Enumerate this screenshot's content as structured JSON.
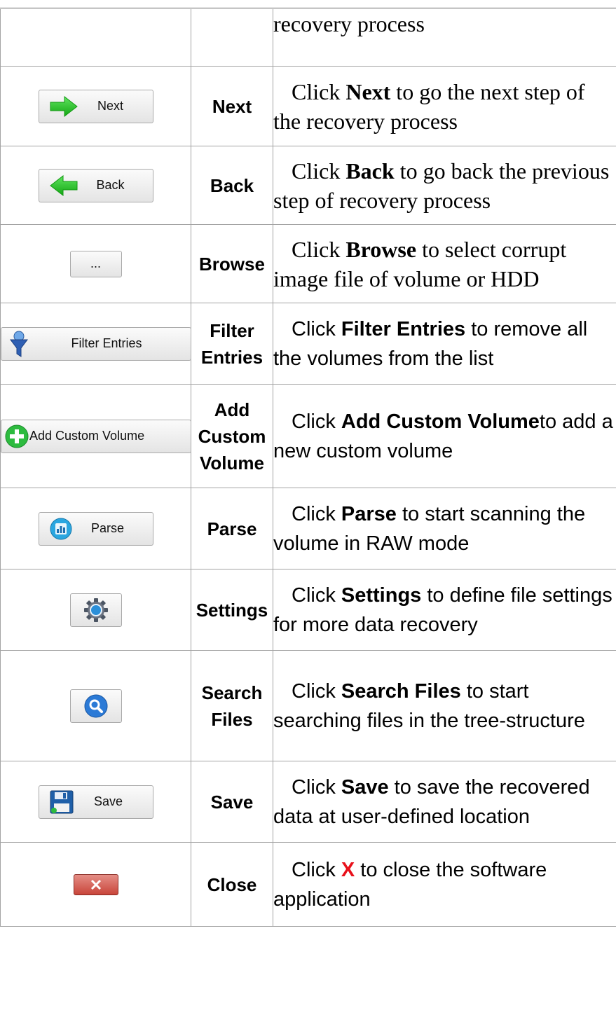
{
  "rows": [
    {
      "id": "top",
      "description": {
        "prefix": "",
        "bold": "",
        "suffix": "recovery process",
        "style": "serif"
      }
    },
    {
      "id": "next",
      "button_label": "Next",
      "icon": "arrow-right-icon",
      "name": "Next",
      "description": {
        "prefix": "Click ",
        "bold": "Next",
        "suffix": " to go the next step of the recovery process",
        "style": "serif"
      }
    },
    {
      "id": "back",
      "button_label": "Back",
      "icon": "arrow-left-icon",
      "name": "Back",
      "description": {
        "prefix": "Click ",
        "bold": "Back",
        "suffix": " to go back the previous step of recovery process",
        "style": "serif"
      }
    },
    {
      "id": "browse",
      "button_label": "...",
      "name": "Browse",
      "description": {
        "prefix": "Click ",
        "bold": "Browse",
        "suffix": " to select corrupt image file of volume or HDD",
        "style": "serif"
      }
    },
    {
      "id": "filter",
      "button_label": "Filter Entries",
      "icon": "funnel-icon",
      "name": "Filter Entries",
      "description": {
        "prefix": "Click ",
        "bold": "Filter Entries",
        "suffix": " to remove all the volumes from the list",
        "style": "sans"
      }
    },
    {
      "id": "add-volume",
      "button_label": "Add Custom Volume",
      "icon": "plus-circle-icon",
      "name": "Add Custom Volume",
      "description": {
        "prefix": "Click ",
        "bold": "Add Custom Volume",
        "suffix": "to add a new custom volume",
        "style": "sans"
      }
    },
    {
      "id": "parse",
      "button_label": "Parse",
      "icon": "chart-circle-icon",
      "name": "Parse",
      "description": {
        "prefix": "Click ",
        "bold": "Parse",
        "suffix": " to start scanning the volume in RAW mode",
        "style": "sans"
      }
    },
    {
      "id": "settings",
      "icon": "gear-icon",
      "name": "Settings",
      "description": {
        "prefix": "Click ",
        "bold": "Settings",
        "suffix": " to define file settings for more data recovery",
        "style": "sans"
      }
    },
    {
      "id": "search",
      "icon": "magnifier-icon",
      "name": "Search Files",
      "description": {
        "prefix": "Click ",
        "bold": "Search Files",
        "suffix": " to start searching files in the tree-structure",
        "style": "sans"
      }
    },
    {
      "id": "save",
      "button_label": "Save",
      "icon": "floppy-icon",
      "name": "Save",
      "description": {
        "prefix": "Click ",
        "bold": "Save",
        "suffix": " to save the recovered data at user-defined location",
        "style": "sans"
      }
    },
    {
      "id": "close",
      "button_label": "X",
      "icon": "close-x-icon",
      "name": "Close",
      "description": {
        "prefix": "Click ",
        "bold": "X",
        "suffix": " to close the software application",
        "style": "sans",
        "bold_color": "#e8101a"
      }
    }
  ],
  "colors": {
    "border": "#a3a3a3",
    "arrow_green": "#1fc21f",
    "close_red": "#c8453a",
    "accent_red": "#e8101a"
  }
}
